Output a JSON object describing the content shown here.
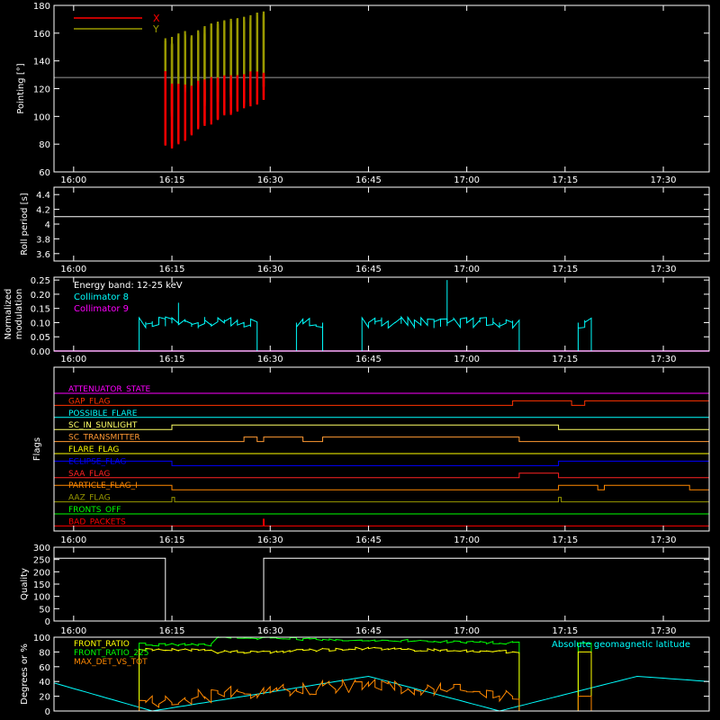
{
  "chart_data": [
    {
      "id": "pointing",
      "type": "line",
      "ylabel": "Pointing [°]",
      "ylim": [
        60,
        180
      ],
      "yticks": [
        60,
        80,
        100,
        120,
        140,
        160,
        180
      ],
      "xlim": [
        "15:57",
        "17:37"
      ],
      "xticks": [
        "16:00",
        "16:15",
        "16:30",
        "16:45",
        "17:00",
        "17:15",
        "17:30"
      ],
      "legend": "top-left",
      "reference_line": 128,
      "series": [
        {
          "name": "X",
          "color": "#ff0000",
          "x": [
            "16:14",
            "16:15",
            "16:17",
            "16:20",
            "16:23",
            "16:26",
            "16:28",
            "16:29"
          ],
          "lower": [
            80,
            78,
            85,
            95,
            103,
            108,
            112,
            115
          ],
          "upper": [
            130,
            120,
            120,
            123,
            126,
            128,
            130,
            131
          ]
        },
        {
          "name": "Y",
          "color": "#999900",
          "x": [
            "16:14",
            "16:15",
            "16:17",
            "16:20",
            "16:23",
            "16:26",
            "16:28",
            "16:29"
          ],
          "lower": [
            105,
            100,
            105,
            110,
            115,
            118,
            120,
            122
          ],
          "upper": [
            155,
            152,
            158,
            162,
            166,
            169,
            172,
            174
          ]
        }
      ]
    },
    {
      "id": "roll",
      "type": "line",
      "ylabel": "Roll period [s]",
      "ylim": [
        3.5,
        4.5
      ],
      "yticks": [
        3.6,
        3.8,
        4.0,
        4.2,
        4.4
      ],
      "xticks": [
        "16:00",
        "16:15",
        "16:30",
        "16:45",
        "17:00",
        "17:15",
        "17:30"
      ],
      "series": [
        {
          "name": "",
          "color": "#ffffff",
          "x": [
            "15:57",
            "17:37"
          ],
          "values": [
            4.1,
            4.1
          ]
        }
      ]
    },
    {
      "id": "modulation",
      "type": "line",
      "ylabel": "Normalized modulation",
      "ylim": [
        0,
        0.26
      ],
      "yticks": [
        0.0,
        0.05,
        0.1,
        0.15,
        0.2,
        0.25
      ],
      "ytick_labels": [
        "0.00",
        "0.05",
        "0.10",
        "0.15",
        "0.20",
        "0.25"
      ],
      "xticks": [
        "16:00",
        "16:15",
        "16:30",
        "16:45",
        "17:00",
        "17:15",
        "17:30"
      ],
      "annotation": "Energy band: 12-25 keV",
      "legend": "top-left",
      "series": [
        {
          "name": "Collimator 8",
          "color": "#00ffff",
          "intervals": [
            [
              "16:10",
              "16:28"
            ],
            [
              "16:34",
              "16:38"
            ],
            [
              "16:44",
              "17:08"
            ],
            [
              "17:17",
              "17:19"
            ]
          ],
          "level": 0.1,
          "spikes": [
            [
              "16:16",
              0.17
            ],
            [
              "16:57",
              0.25
            ]
          ]
        },
        {
          "name": "Collimator 9",
          "color": "#ff00ff",
          "x": [
            "15:57",
            "17:37"
          ],
          "values": [
            0,
            0
          ]
        }
      ]
    },
    {
      "id": "flags",
      "type": "line",
      "ylabel": "Flags",
      "xticks": [
        "16:00",
        "16:15",
        "16:30",
        "16:45",
        "17:00",
        "17:15",
        "17:30"
      ],
      "series": [
        {
          "name": "ATTENUATOR_STATE",
          "color": "#ff00ff",
          "high": []
        },
        {
          "name": "GAP_FLAG",
          "color": "#ff3300",
          "high": [
            [
              "17:07",
              "17:16"
            ],
            [
              "17:18",
              "17:37"
            ]
          ]
        },
        {
          "name": "POSSIBLE_FLARE",
          "color": "#00ffff",
          "high": []
        },
        {
          "name": "SC_IN_SUNLIGHT",
          "color": "#ffff66",
          "high": [
            [
              "16:15",
              "17:14"
            ]
          ]
        },
        {
          "name": "SC_TRANSMITTER",
          "color": "#ff9933",
          "high": [
            [
              "16:26",
              "16:28"
            ],
            [
              "16:29",
              "16:35"
            ],
            [
              "16:38",
              "17:08"
            ]
          ]
        },
        {
          "name": "FLARE_FLAG",
          "color": "#ffff00",
          "high": []
        },
        {
          "name": "ECLIPSE_FLAG",
          "color": "#0000ff",
          "high": [
            [
              "15:57",
              "16:15"
            ],
            [
              "17:14",
              "17:37"
            ]
          ]
        },
        {
          "name": "SAA_FLAG",
          "color": "#ff2222",
          "high": [
            [
              "17:08",
              "17:14"
            ]
          ]
        },
        {
          "name": "PARTICLE_FLAG_I",
          "color": "#ff8800",
          "high": [
            [
              "15:57",
              "16:15"
            ],
            [
              "17:14",
              "17:20"
            ],
            [
              "17:21",
              "17:34"
            ]
          ]
        },
        {
          "name": "AAZ_FLAG",
          "color": "#999900",
          "high": [
            [
              "16:15",
              "16:15"
            ],
            [
              "17:14",
              "17:14"
            ]
          ]
        },
        {
          "name": "FRONTS_OFF",
          "color": "#00ff00",
          "high": []
        },
        {
          "name": "BAD_PACKETS",
          "color": "#ff0000",
          "high": [],
          "spikes": [
            "16:29"
          ]
        }
      ]
    },
    {
      "id": "quality",
      "type": "line",
      "ylabel": "Quality",
      "ylim": [
        0,
        300
      ],
      "yticks": [
        0,
        50,
        100,
        150,
        200,
        250,
        300
      ],
      "xticks": [
        "16:00",
        "16:15",
        "16:30",
        "16:45",
        "17:00",
        "17:15",
        "17:30"
      ],
      "series": [
        {
          "name": "",
          "color": "#ffffff",
          "x": [
            "15:57",
            "16:14",
            "16:14",
            "16:29",
            "16:29",
            "17:37"
          ],
          "values": [
            255,
            255,
            0,
            0,
            255,
            255
          ]
        }
      ]
    },
    {
      "id": "ratios",
      "type": "line",
      "ylabel": "Degrees or %",
      "ylim": [
        0,
        100
      ],
      "yticks": [
        0,
        20,
        40,
        60,
        80,
        100
      ],
      "xlim": [
        "15:57",
        "17:37"
      ],
      "legend": "top-left",
      "series": [
        {
          "name": "FRONT_RATIO",
          "color": "#ffff00",
          "x": [
            "16:10",
            "16:21",
            "16:21",
            "16:30",
            "16:35",
            "16:45",
            "16:52",
            "17:08"
          ],
          "values": [
            83,
            83,
            80,
            80,
            82,
            85,
            83,
            80
          ]
        },
        {
          "name": "FRONT_RATIO_225",
          "color": "#00ff00",
          "x": [
            "16:10",
            "16:21",
            "16:21",
            "17:08"
          ],
          "values": [
            90,
            90,
            100,
            92
          ]
        },
        {
          "name": "MAX_DET_VS_TOT",
          "color": "#ff8800",
          "x": [
            "16:10",
            "16:14",
            "16:20",
            "16:25",
            "16:45",
            "16:55",
            "17:08"
          ],
          "values": [
            12,
            15,
            20,
            25,
            35,
            30,
            20
          ]
        },
        {
          "name": "Absolute geomagnetic latitude",
          "color": "#00ffff",
          "x": [
            "15:57",
            "16:12",
            "16:45",
            "17:05",
            "17:26",
            "17:37"
          ],
          "values": [
            38,
            0,
            47,
            0,
            47,
            40
          ]
        }
      ]
    }
  ]
}
